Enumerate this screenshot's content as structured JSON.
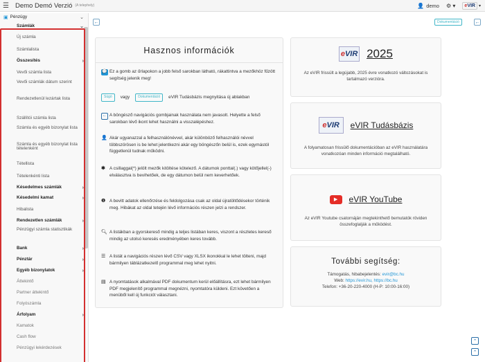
{
  "header": {
    "title": "Demo Demó Verzió",
    "subtitle": "(A telephely)",
    "user": "demo",
    "logo_text": "eVIR"
  },
  "sidebar": {
    "root": "Pénzügy",
    "section": "Számlák",
    "items": [
      {
        "label": "Új számla",
        "type": "item"
      },
      {
        "label": "Számlalista",
        "type": "item"
      },
      {
        "label": "Összesítés",
        "type": "group"
      },
      {
        "label": "Vevői számla lista",
        "type": "item"
      },
      {
        "label": "Vevői számlák dátum szerint",
        "type": "item2"
      },
      {
        "label": "Rendezetlenül lezártak lista",
        "type": "item2"
      },
      {
        "label": "Szállítói számla lista",
        "type": "item"
      },
      {
        "label": "Számla és egyéb bizonylat lista",
        "type": "item2"
      },
      {
        "label": "Számla és egyéb bizonylat lista tételenként",
        "type": "item2"
      },
      {
        "label": "Tétellista",
        "type": "item"
      },
      {
        "label": "Tételenkénti lista",
        "type": "item"
      },
      {
        "label": "Késedelmes számlák",
        "type": "group"
      },
      {
        "label": "Késedelmi kamat",
        "type": "group"
      },
      {
        "label": "Hibalista",
        "type": "item"
      },
      {
        "label": "Rendezetlen számlák",
        "type": "group"
      },
      {
        "label": "Pénzügyi számla statisztikák",
        "type": "item2"
      }
    ],
    "bottom": [
      {
        "label": "Bank",
        "type": "group"
      },
      {
        "label": "Pénztár",
        "type": "group"
      },
      {
        "label": "Egyéb bizonylatok",
        "type": "group"
      },
      {
        "label": "Áttekintő",
        "type": "item"
      },
      {
        "label": "Partner áttekintő",
        "type": "item"
      },
      {
        "label": "Folyószámla",
        "type": "item"
      },
      {
        "label": "Árfolyam",
        "type": "group"
      },
      {
        "label": "Kamatok",
        "type": "item"
      },
      {
        "label": "Cash flow",
        "type": "item"
      },
      {
        "label": "Pénzügyi lekérdezések",
        "type": "item"
      }
    ]
  },
  "toolbar": {
    "doc_label": "Dokumentáció"
  },
  "info": {
    "title": "Hasznos információk",
    "row1": "Ez a gomb az űrlapokon a jobb felső sarokban látható, rákattintva a mezőkhöz fűzött segítség jelenik meg!",
    "help_pill": "Súgó",
    "vagy": "vagy",
    "doc_pill": "Dokumentáció",
    "row2": "eVIR Tudásbázis megnyitása új ablakban",
    "row3": "A böngésző navigációs gombjainak használata nem javasolt. Helyette a felső sarokban lévő ikont lehet használni a visszalépéshez.",
    "row4": "Akár ugyanazzal a felhasználónévvel, akár különböző felhasználói névvel többszörösen is be lehet jelentkezni akár egy böngészőn belül is, ezek egymástól függetlenül tudnak működni.",
    "row5": "A csillaggal(*) jelölt mezők kitöltése kötelező. A dátumok ponttal(.) vagy kötőjellel(-) elválasztva is bevihetőek, de egy dátumon belül nem keverhetőek.",
    "row6": "A bevitt adatok ellenőrzése és feldolgozása csak az oldal újratöltődésekor történik meg. Hibákat az oldal tetején lévő információs részen jelzi a rendszer.",
    "row7": "A listákban a gyorskereső mindig a teljes listában keres, viszont a részletes kereső mindig az utolsó keresés eredményében keres tovább.",
    "row8": "A listát a navigációs részen lévő CSV vagy XLSX ikonokkal le lehet tölteni, majd bármilyen táblázatkezelő programmal meg lehet nyitni.",
    "row9": "A nyomtatások alkalmával PDF dokumentum kerül előállításra, ezt lehet bármilyen PDF megjelenítő programmal megnézni, nyomtatóra küldeni. Ezt követően a menüből kell új funkciót választani."
  },
  "cards": {
    "c1_title": "2025",
    "c1_text": "Az eVIR frissült a legújabb, 2025 évre vonatkozó változásokat is tartalmazó verzióra.",
    "c2_title": "eVIR Tudásbázis",
    "c2_text": "A folyamatosan frissülő dokumentációban az eVIR használatára vonatkozóan minden információ megtalálható.",
    "c3_title": "eVIR YouTube",
    "c3_text": "Az eVIR Youtube csatornáján megtekinthető bemutatók röviden összefoglalják a működést.",
    "help_title": "További segítség:",
    "help_l1_label": "Támogatás, hibabejelentés: ",
    "help_l1_link": "evir@bc.hu",
    "help_l2_label": "Web: ",
    "help_l2_link": "https://evir.hu, https://bc.hu",
    "help_l3": "Telefon: +36-20-220-4000 (H-P: 10:00-16:00)"
  },
  "colors": {
    "accent": "#2196d6",
    "frame": "#d32f2f",
    "youtube": "#e52d27",
    "navy": "#1c3b73"
  }
}
